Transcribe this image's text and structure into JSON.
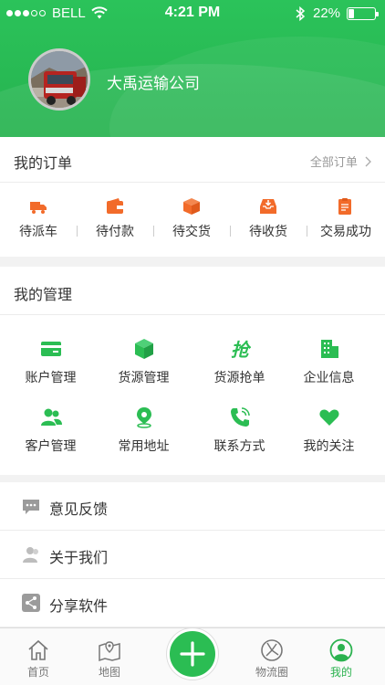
{
  "status_bar": {
    "carrier": "BELL",
    "time": "4:21 PM",
    "battery": "22%",
    "battery_level": 0.22
  },
  "profile": {
    "company_name": "大禹运输公司"
  },
  "orders": {
    "title": "我的订单",
    "all_link": "全部订单",
    "items": [
      {
        "label": "待派车",
        "icon": "truck-icon"
      },
      {
        "label": "待付款",
        "icon": "wallet-icon"
      },
      {
        "label": "待交货",
        "icon": "package-icon"
      },
      {
        "label": "待收货",
        "icon": "inbox-icon"
      },
      {
        "label": "交易成功",
        "icon": "clipboard-icon"
      }
    ]
  },
  "management": {
    "title": "我的管理",
    "items": [
      {
        "label": "账户管理",
        "icon": "card-icon"
      },
      {
        "label": "货源管理",
        "icon": "cube-icon"
      },
      {
        "label": "货源抢单",
        "icon": "grab-icon",
        "glyph": "抢"
      },
      {
        "label": "企业信息",
        "icon": "building-icon"
      },
      {
        "label": "客户管理",
        "icon": "users-icon"
      },
      {
        "label": "常用地址",
        "icon": "location-pin-icon"
      },
      {
        "label": "联系方式",
        "icon": "phone-icon"
      },
      {
        "label": "我的关注",
        "icon": "heart-icon"
      }
    ]
  },
  "list": [
    {
      "label": "意见反馈",
      "icon": "feedback-icon"
    },
    {
      "label": "关于我们",
      "icon": "about-icon"
    },
    {
      "label": "分享软件",
      "icon": "share-icon"
    }
  ],
  "tabbar": {
    "items": [
      {
        "label": "首页",
        "icon": "home-icon"
      },
      {
        "label": "地图",
        "icon": "map-icon"
      },
      {
        "label": "",
        "icon": "plus-icon"
      },
      {
        "label": "物流圈",
        "icon": "logistics-circle-icon"
      },
      {
        "label": "我的",
        "icon": "profile-icon"
      }
    ],
    "active_index": 4
  },
  "colors": {
    "primary": "#2bbd53",
    "accent_orange": "#f26b2a",
    "icon_gray": "#9b9b9b"
  }
}
